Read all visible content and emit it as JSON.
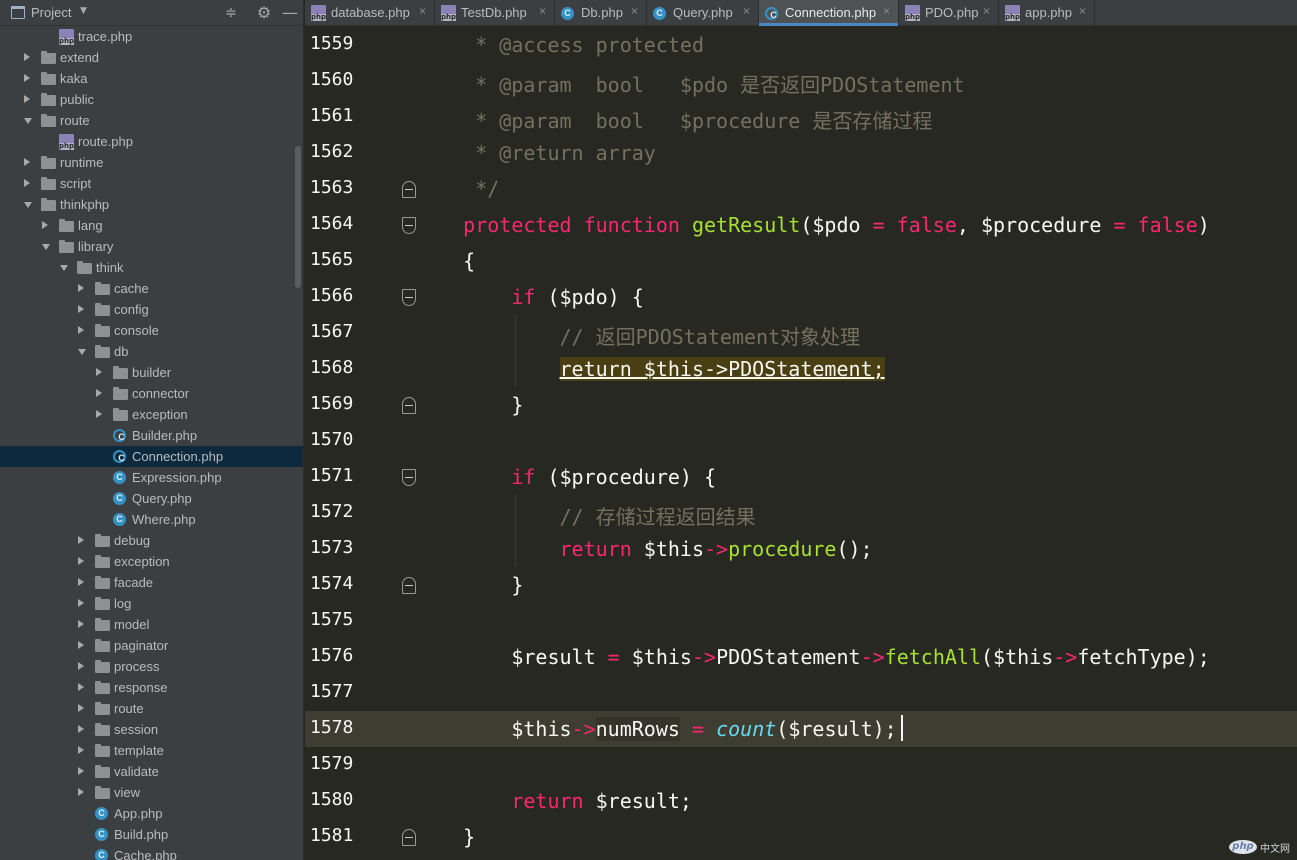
{
  "panel": {
    "title": "Project",
    "icons": {
      "title": "project-window-icon",
      "caret": "chevron-down-icon",
      "collapse": "collapse-all-icon",
      "gear": "gear-icon",
      "hide": "minimize-icon"
    }
  },
  "tree": [
    {
      "label": "trace.php",
      "type": "php",
      "depth": 2,
      "arrow": "none"
    },
    {
      "label": "extend",
      "type": "folder",
      "depth": 1,
      "arrow": "closed"
    },
    {
      "label": "kaka",
      "type": "folder",
      "depth": 1,
      "arrow": "closed"
    },
    {
      "label": "public",
      "type": "folder",
      "depth": 1,
      "arrow": "closed"
    },
    {
      "label": "route",
      "type": "folder",
      "depth": 1,
      "arrow": "open"
    },
    {
      "label": "route.php",
      "type": "php",
      "depth": 2,
      "arrow": "none"
    },
    {
      "label": "runtime",
      "type": "folder",
      "depth": 1,
      "arrow": "closed"
    },
    {
      "label": "script",
      "type": "folder",
      "depth": 1,
      "arrow": "closed"
    },
    {
      "label": "thinkphp",
      "type": "folder",
      "depth": 1,
      "arrow": "open"
    },
    {
      "label": "lang",
      "type": "folder",
      "depth": 2,
      "arrow": "closed"
    },
    {
      "label": "library",
      "type": "folder",
      "depth": 2,
      "arrow": "open"
    },
    {
      "label": "think",
      "type": "folder",
      "depth": 3,
      "arrow": "open"
    },
    {
      "label": "cache",
      "type": "folder",
      "depth": 4,
      "arrow": "closed"
    },
    {
      "label": "config",
      "type": "folder",
      "depth": 4,
      "arrow": "closed"
    },
    {
      "label": "console",
      "type": "folder",
      "depth": 4,
      "arrow": "closed"
    },
    {
      "label": "db",
      "type": "folder",
      "depth": 4,
      "arrow": "open"
    },
    {
      "label": "builder",
      "type": "folder",
      "depth": 5,
      "arrow": "closed"
    },
    {
      "label": "connector",
      "type": "folder",
      "depth": 5,
      "arrow": "closed"
    },
    {
      "label": "exception",
      "type": "folder",
      "depth": 5,
      "arrow": "closed"
    },
    {
      "label": "Builder.php",
      "type": "class-abstract",
      "depth": 5,
      "arrow": "none"
    },
    {
      "label": "Connection.php",
      "type": "class-abstract",
      "depth": 5,
      "arrow": "none",
      "selected": true
    },
    {
      "label": "Expression.php",
      "type": "class",
      "depth": 5,
      "arrow": "none"
    },
    {
      "label": "Query.php",
      "type": "class",
      "depth": 5,
      "arrow": "none"
    },
    {
      "label": "Where.php",
      "type": "class",
      "depth": 5,
      "arrow": "none"
    },
    {
      "label": "debug",
      "type": "folder",
      "depth": 4,
      "arrow": "closed"
    },
    {
      "label": "exception",
      "type": "folder",
      "depth": 4,
      "arrow": "closed"
    },
    {
      "label": "facade",
      "type": "folder",
      "depth": 4,
      "arrow": "closed"
    },
    {
      "label": "log",
      "type": "folder",
      "depth": 4,
      "arrow": "closed"
    },
    {
      "label": "model",
      "type": "folder",
      "depth": 4,
      "arrow": "closed"
    },
    {
      "label": "paginator",
      "type": "folder",
      "depth": 4,
      "arrow": "closed"
    },
    {
      "label": "process",
      "type": "folder",
      "depth": 4,
      "arrow": "closed"
    },
    {
      "label": "response",
      "type": "folder",
      "depth": 4,
      "arrow": "closed"
    },
    {
      "label": "route",
      "type": "folder",
      "depth": 4,
      "arrow": "closed"
    },
    {
      "label": "session",
      "type": "folder",
      "depth": 4,
      "arrow": "closed"
    },
    {
      "label": "template",
      "type": "folder",
      "depth": 4,
      "arrow": "closed"
    },
    {
      "label": "validate",
      "type": "folder",
      "depth": 4,
      "arrow": "closed"
    },
    {
      "label": "view",
      "type": "folder",
      "depth": 4,
      "arrow": "closed"
    },
    {
      "label": "App.php",
      "type": "class",
      "depth": 4,
      "arrow": "none"
    },
    {
      "label": "Build.php",
      "type": "class",
      "depth": 4,
      "arrow": "none"
    },
    {
      "label": "Cache.php",
      "type": "class",
      "depth": 4,
      "arrow": "none"
    }
  ],
  "tabs": [
    {
      "label": "database.php",
      "icon": "php",
      "active": false
    },
    {
      "label": "TestDb.php",
      "icon": "php-test",
      "active": false
    },
    {
      "label": "Db.php",
      "icon": "class",
      "active": false
    },
    {
      "label": "Query.php",
      "icon": "class",
      "active": false
    },
    {
      "label": "Connection.php",
      "icon": "class-abstract",
      "active": true
    },
    {
      "label": "PDO.php",
      "icon": "php",
      "active": false
    },
    {
      "label": "app.php",
      "icon": "php",
      "active": false
    }
  ],
  "tab_close_glyph": "×",
  "editor": {
    "current_line": "1578",
    "lines": [
      {
        "no": "1559",
        "fold": "",
        "tokens": [
          [
            "c",
            "     * @access protected"
          ]
        ]
      },
      {
        "no": "1560",
        "fold": "",
        "tokens": [
          [
            "c",
            "     * @param  bool   $pdo 是否返回PDOStatement"
          ]
        ]
      },
      {
        "no": "1561",
        "fold": "",
        "tokens": [
          [
            "c",
            "     * @param  bool   $procedure 是否存储过程"
          ]
        ]
      },
      {
        "no": "1562",
        "fold": "",
        "tokens": [
          [
            "c",
            "     * @return array"
          ]
        ]
      },
      {
        "no": "1563",
        "fold": "up",
        "tokens": [
          [
            "c",
            "     */"
          ]
        ]
      },
      {
        "no": "1564",
        "fold": "down",
        "tokens": [
          [
            "k",
            "    protected "
          ],
          [
            "k",
            "function "
          ],
          [
            "f",
            "getResult"
          ],
          [
            "p",
            "($pdo "
          ],
          [
            "o",
            "= "
          ],
          [
            "k",
            "false"
          ],
          [
            "p",
            ", $procedure "
          ],
          [
            "o",
            "= "
          ],
          [
            "k",
            "false"
          ],
          [
            "p",
            ")"
          ]
        ]
      },
      {
        "no": "1565",
        "fold": "",
        "tokens": [
          [
            "p",
            "    {"
          ]
        ]
      },
      {
        "no": "1566",
        "fold": "down",
        "tokens": [
          [
            "k",
            "        if "
          ],
          [
            "p",
            "($pdo) {"
          ]
        ]
      },
      {
        "no": "1567",
        "fold": "",
        "tokens": [
          [
            "c",
            "            // 返回PDOStatement对象处理"
          ]
        ]
      },
      {
        "no": "1568",
        "fold": "",
        "tokens": [
          [
            "p",
            "            "
          ],
          [
            "u",
            "return $this->PDOStatement;"
          ]
        ]
      },
      {
        "no": "1569",
        "fold": "up",
        "tokens": [
          [
            "p",
            "        }"
          ]
        ]
      },
      {
        "no": "1570",
        "fold": "",
        "tokens": []
      },
      {
        "no": "1571",
        "fold": "down",
        "tokens": [
          [
            "k",
            "        if "
          ],
          [
            "p",
            "($procedure) {"
          ]
        ]
      },
      {
        "no": "1572",
        "fold": "",
        "tokens": [
          [
            "c",
            "            // 存储过程返回结果"
          ]
        ]
      },
      {
        "no": "1573",
        "fold": "",
        "tokens": [
          [
            "k",
            "            return "
          ],
          [
            "p",
            "$this"
          ],
          [
            "o",
            "->"
          ],
          [
            "f",
            "procedure"
          ],
          [
            "p",
            "();"
          ]
        ]
      },
      {
        "no": "1574",
        "fold": "up",
        "tokens": [
          [
            "p",
            "        }"
          ]
        ]
      },
      {
        "no": "1575",
        "fold": "",
        "tokens": []
      },
      {
        "no": "1576",
        "fold": "",
        "tokens": [
          [
            "p",
            "        $result "
          ],
          [
            "o",
            "= "
          ],
          [
            "p",
            "$this"
          ],
          [
            "o",
            "->"
          ],
          [
            "p",
            "PDOStatement"
          ],
          [
            "o",
            "->"
          ],
          [
            "f",
            "fetchAll"
          ],
          [
            "p",
            "($this"
          ],
          [
            "o",
            "->"
          ],
          [
            "p",
            "fetchType);"
          ]
        ]
      },
      {
        "no": "1577",
        "fold": "",
        "tokens": []
      },
      {
        "no": "1578",
        "fold": "",
        "tokens": [
          [
            "p",
            "        $this"
          ],
          [
            "o",
            "->"
          ],
          [
            "w",
            "numRows"
          ],
          [
            "p",
            " "
          ],
          [
            "o",
            "= "
          ],
          [
            "i",
            "count"
          ],
          [
            "p",
            "($result);"
          ]
        ]
      },
      {
        "no": "1579",
        "fold": "",
        "tokens": []
      },
      {
        "no": "1580",
        "fold": "",
        "tokens": [
          [
            "k",
            "        return "
          ],
          [
            "p",
            "$result;"
          ]
        ]
      },
      {
        "no": "1581",
        "fold": "up",
        "tokens": [
          [
            "p",
            "    }"
          ]
        ]
      }
    ]
  },
  "watermark": {
    "logo": "php",
    "text": "中文网"
  },
  "colors": {
    "background": "#272822",
    "keyword": "#f92672",
    "function": "#a6e22e",
    "comment": "#75715e",
    "builtin": "#66d9ef",
    "selection": "#0d293e",
    "tab_accent": "#4a88c7"
  }
}
